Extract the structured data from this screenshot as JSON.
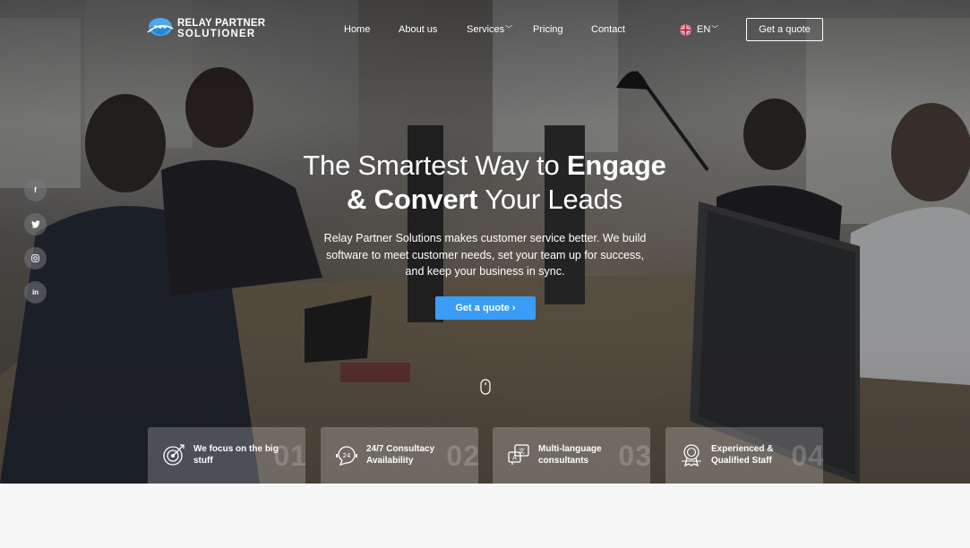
{
  "brand": {
    "line1": "RELAY PARTNER",
    "line2": "SOLUTIONER"
  },
  "nav": {
    "home": "Home",
    "about": "About us",
    "services": "Services",
    "pricing": "Pricing",
    "contact": "Contact",
    "language": "EN",
    "quote_button": "Get a quote"
  },
  "social": [
    {
      "icon": "facebook-icon",
      "label": "f"
    },
    {
      "icon": "twitter-icon",
      "label": "t"
    },
    {
      "icon": "instagram-icon",
      "label": "◎"
    },
    {
      "icon": "linkedin-icon",
      "label": "in"
    }
  ],
  "hero": {
    "headline_part1": "The Smartest Way to ",
    "headline_bold1": "Engage",
    "headline_bold2": "& Convert",
    "headline_part2": " Your Leads",
    "lead": "Relay Partner Solutions makes customer service better. We build software to meet customer needs, set your team up for success, and keep your business in sync.",
    "cta": "Get a quote ›"
  },
  "features": [
    {
      "text": "We focus on the big stuff",
      "num": "01",
      "icon": "target-icon"
    },
    {
      "text": "24/7 Consultacy Availability",
      "num": "02",
      "icon": "support-chat-icon"
    },
    {
      "text": "Multi-language consultants",
      "num": "03",
      "icon": "translate-icon"
    },
    {
      "text": "Experienced & Qualified Staff",
      "num": "04",
      "icon": "award-badge-icon"
    }
  ],
  "colors": {
    "accent": "#3b9cf6",
    "logo_blue": "#4aa8f0"
  }
}
